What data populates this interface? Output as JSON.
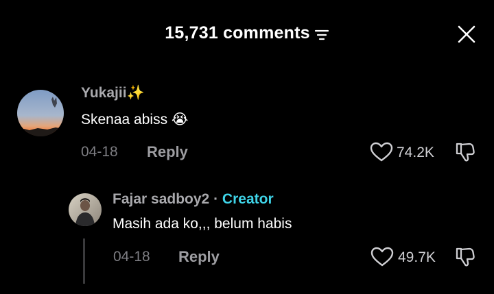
{
  "header": {
    "title": "15,731 comments",
    "filter_icon": "filter-sort-icon",
    "close_icon": "close-icon"
  },
  "comments": [
    {
      "username": "Yukajii✨",
      "text": "Skenaa abiss 😭",
      "date": "04-18",
      "reply_label": "Reply",
      "likes": "74.2K",
      "avatar": "sunset-sky-avatar"
    }
  ],
  "reply": {
    "username": "Fajar sadboy2",
    "separator": "·",
    "badge": "Creator",
    "text": "Masih ada ko,,, belum habis",
    "date": "04-18",
    "reply_label": "Reply",
    "likes": "49.7K",
    "avatar": "person-photo-avatar"
  },
  "colors": {
    "background": "#000000",
    "username": "#a9a9ad",
    "creator_badge": "#3fd4e8",
    "meta": "#7d7d82"
  }
}
